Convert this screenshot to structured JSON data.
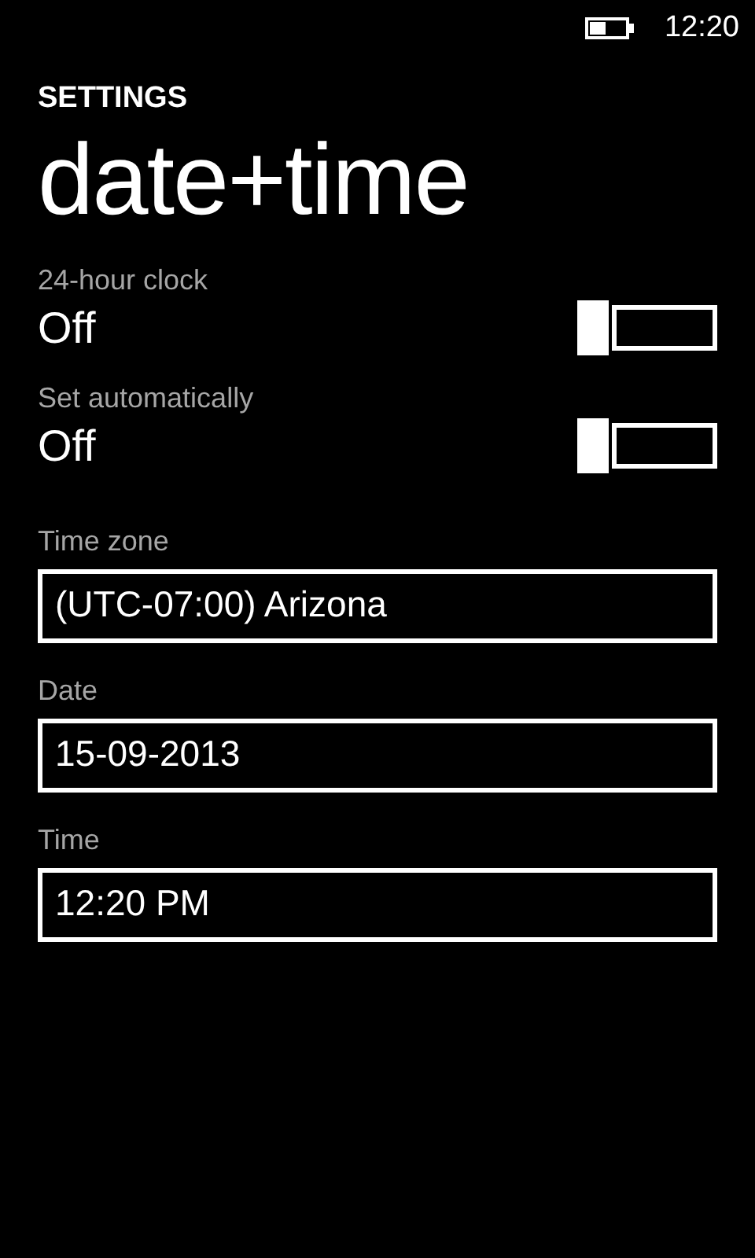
{
  "status_bar": {
    "time": "12:20"
  },
  "header": {
    "section": "SETTINGS",
    "title": "date+time"
  },
  "toggles": [
    {
      "label": "24-hour clock",
      "value": "Off",
      "on": false
    },
    {
      "label": "Set automatically",
      "value": "Off",
      "on": false
    }
  ],
  "fields": [
    {
      "label": "Time zone",
      "value": "(UTC-07:00) Arizona"
    },
    {
      "label": "Date",
      "value": "15-09-2013"
    },
    {
      "label": "Time",
      "value": "12:20 PM"
    }
  ]
}
